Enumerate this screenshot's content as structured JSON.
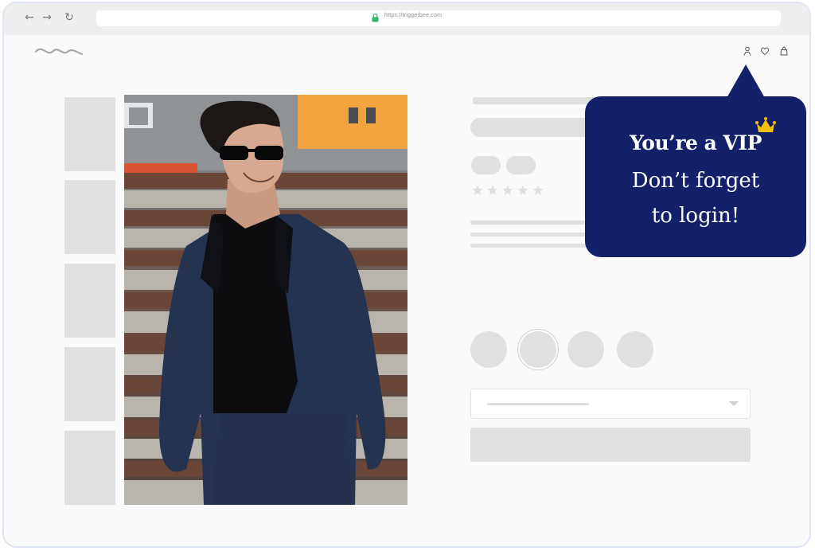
{
  "browser": {
    "back_icon": "arrow-left",
    "forward_icon": "arrow-right",
    "reload_icon": "reload",
    "url": "https://triggerbee.com",
    "secure_icon": "lock-icon"
  },
  "header": {
    "logo_icon": "wave-logo",
    "icons": [
      "user-icon",
      "heart-icon",
      "bag-icon"
    ]
  },
  "product": {
    "image_alt": "man in navy suit and sunglasses",
    "rating_stars": 5,
    "placeholder_color": "#e0e0e0"
  },
  "popup": {
    "title": "You’re a VIP",
    "line1": "Don’t forget",
    "line2": "to login!",
    "crown_icon": "crown-icon",
    "bg_color": "#14206a",
    "crown_color": "#f2c200"
  }
}
